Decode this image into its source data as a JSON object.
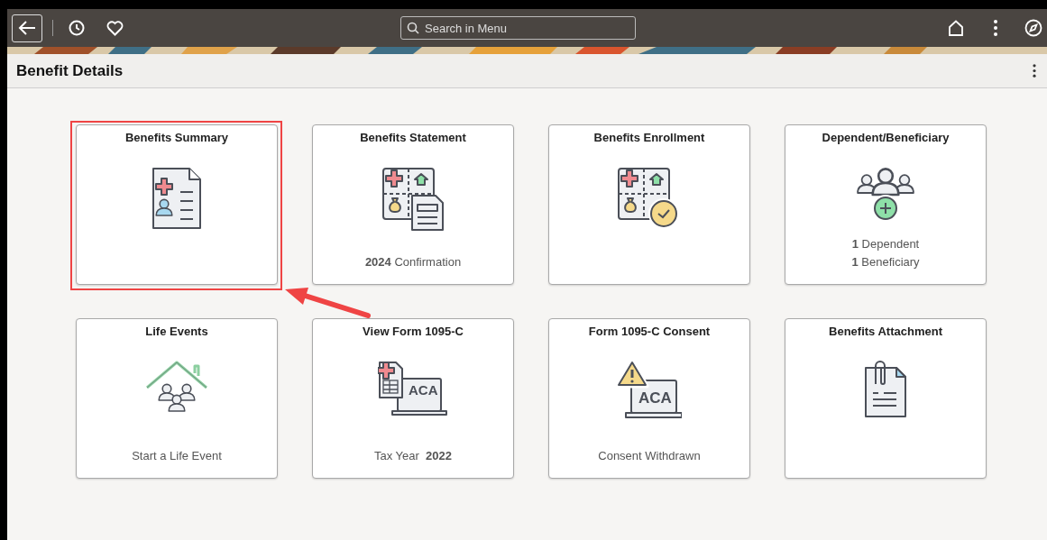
{
  "top_bar": {
    "search": {
      "placeholder": "Search in Menu"
    }
  },
  "page": {
    "title": "Benefit Details"
  },
  "tiles": [
    {
      "title": "Benefits Summary",
      "highlighted": true
    },
    {
      "title": "Benefits Statement",
      "lines": [
        "**2024** Confirmation"
      ],
      "highlighted": false
    },
    {
      "title": "Benefits Enrollment",
      "highlighted": false
    },
    {
      "title": "Dependent/Beneficiary",
      "lines": [
        "**1** Dependent",
        "**1** Beneficiary"
      ],
      "highlighted": false
    },
    {
      "title": "Life Events",
      "lines": [
        "Start a Life Event"
      ],
      "highlighted": false
    },
    {
      "title": "View Form 1095-C",
      "lines": [
        "Tax Year  **2022**"
      ],
      "icon_text": "ACA",
      "highlighted": false
    },
    {
      "title": "Form 1095-C Consent",
      "lines": [
        "Consent Withdrawn"
      ],
      "icon_text": "ACA",
      "highlighted": false
    },
    {
      "title": "Benefits Attachment",
      "highlighted": false
    }
  ]
}
